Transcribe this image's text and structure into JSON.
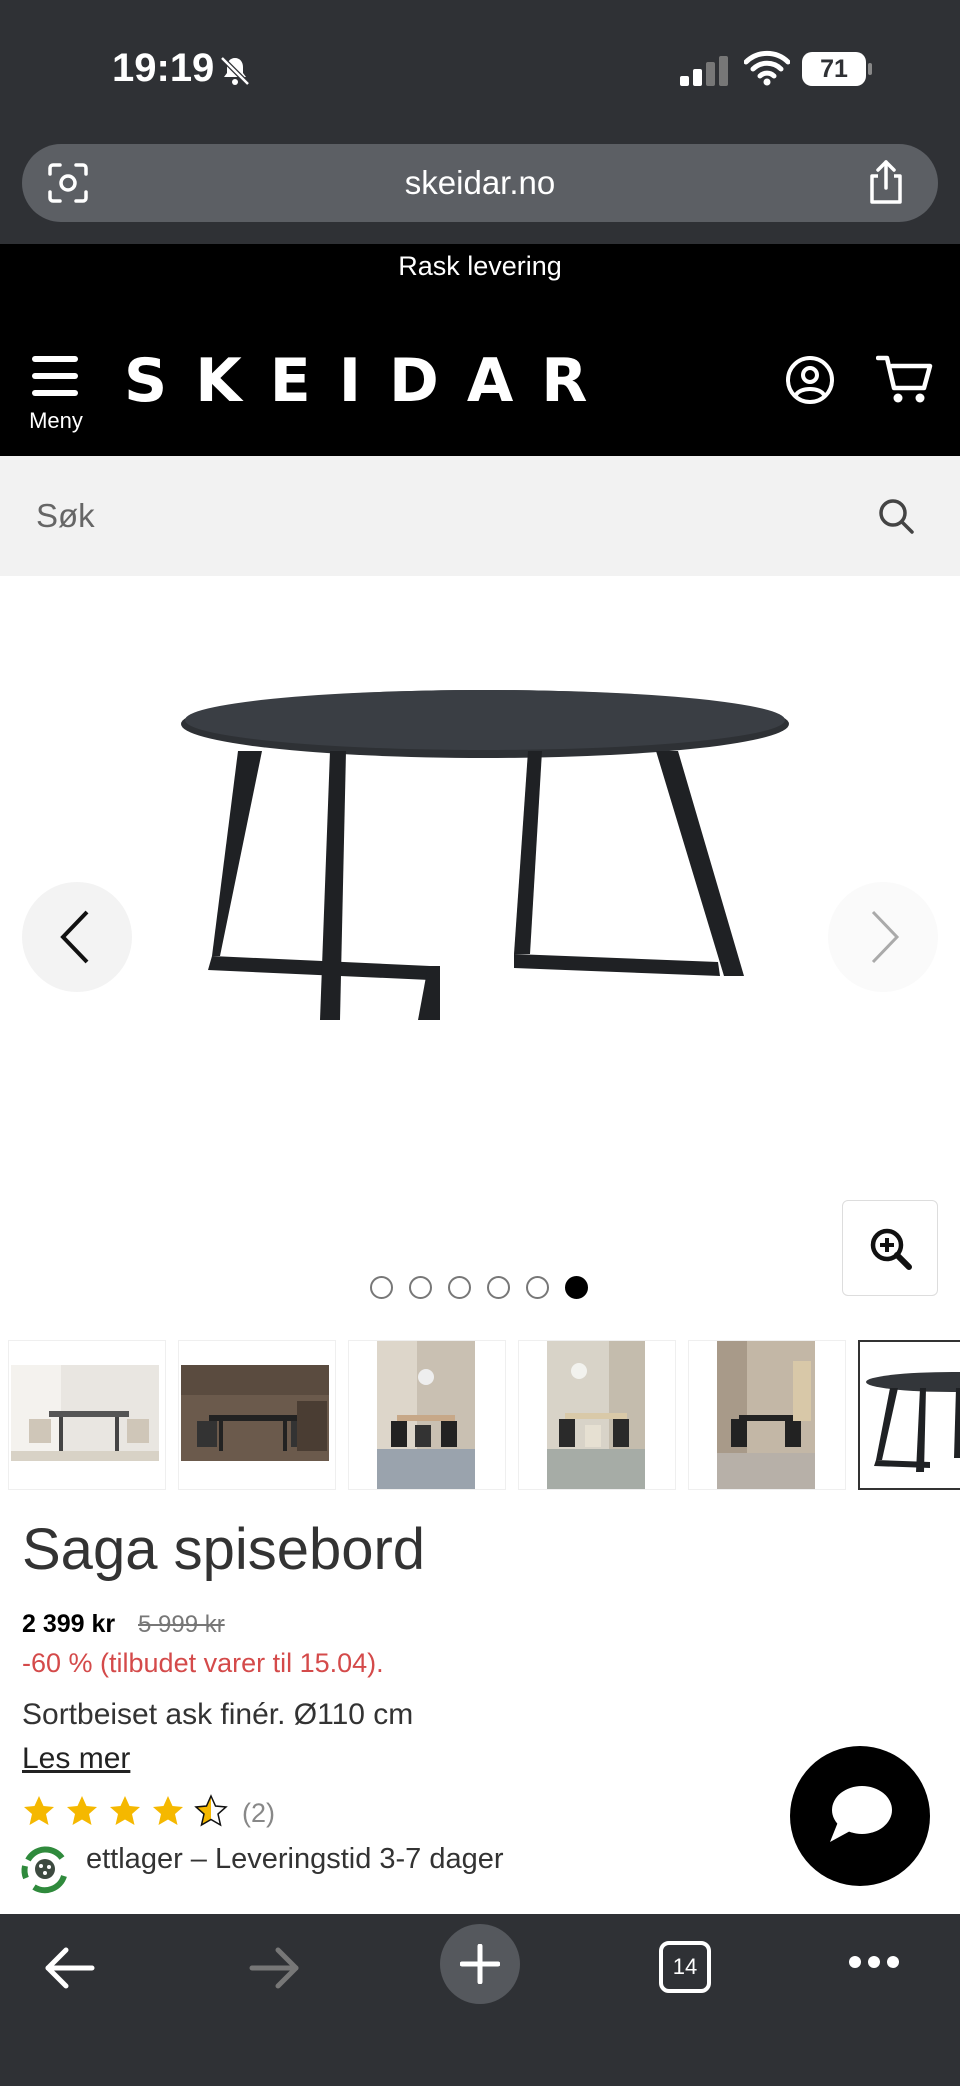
{
  "status_bar": {
    "time": "19:19",
    "battery": "71"
  },
  "browser": {
    "url": "skeidar.no",
    "tab_count": "14"
  },
  "site": {
    "promo_text": "Rask levering",
    "menu_label": "Meny",
    "logo_text": "SKEIDAR",
    "search_placeholder": "Søk"
  },
  "gallery": {
    "image_count": 6,
    "active_index": 5,
    "thumbnail_count": 6
  },
  "product": {
    "title": "Saga spisebord",
    "price_now": "2 399 kr",
    "price_old": "5 999 kr",
    "discount_text": "-60 % (tilbudet varer til 15.04).",
    "description": "Sortbeiset ask finér. Ø110 cm",
    "read_more": "Les mer",
    "rating": 4.5,
    "rating_count": "(2)",
    "stock_text": "ettlager – Leveringstid 3-7 dager"
  },
  "colors": {
    "accent_discount": "#d44a4a",
    "star": "#f5b800",
    "header_bg": "#000000",
    "chrome_bg": "#2f3135"
  },
  "icons": [
    "bell-slash-icon",
    "signal-icon",
    "wifi-icon",
    "battery-icon",
    "camera-lens-icon",
    "share-icon",
    "menu-icon",
    "user-icon",
    "cart-icon",
    "search-icon",
    "chevron-left-icon",
    "chevron-right-icon",
    "zoom-in-icon",
    "chat-icon",
    "back-icon",
    "forward-icon",
    "plus-icon",
    "more-icon"
  ]
}
